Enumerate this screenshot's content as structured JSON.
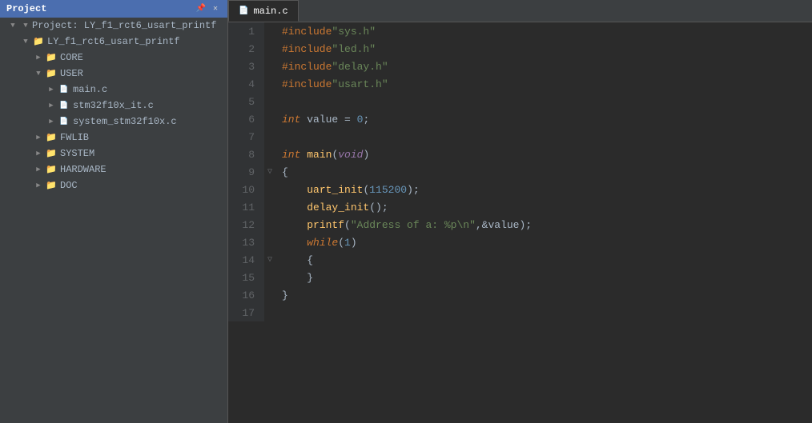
{
  "titlebar": {
    "label": "Project"
  },
  "sidebar": {
    "header": "Project",
    "pin_label": "📌",
    "close_label": "✕",
    "items": [
      {
        "id": "project-root",
        "label": "Project: LY_f1_rct6_usart_printf",
        "indent": 1,
        "type": "root",
        "expanded": true
      },
      {
        "id": "project-node",
        "label": "LY_f1_rct6_usart_printf",
        "indent": 2,
        "type": "folder",
        "expanded": true
      },
      {
        "id": "core",
        "label": "CORE",
        "indent": 3,
        "type": "folder",
        "expanded": false
      },
      {
        "id": "user",
        "label": "USER",
        "indent": 3,
        "type": "folder",
        "expanded": true
      },
      {
        "id": "main-c",
        "label": "main.c",
        "indent": 4,
        "type": "file"
      },
      {
        "id": "stm32f10x",
        "label": "stm32f10x_it.c",
        "indent": 4,
        "type": "file"
      },
      {
        "id": "system-stm",
        "label": "system_stm32f10x.c",
        "indent": 4,
        "type": "file"
      },
      {
        "id": "fwlib",
        "label": "FWLIB",
        "indent": 3,
        "type": "folder",
        "expanded": false
      },
      {
        "id": "system",
        "label": "SYSTEM",
        "indent": 3,
        "type": "folder",
        "expanded": false
      },
      {
        "id": "hardware",
        "label": "HARDWARE",
        "indent": 3,
        "type": "folder",
        "expanded": false
      },
      {
        "id": "doc",
        "label": "DOC",
        "indent": 3,
        "type": "folder",
        "expanded": false
      }
    ]
  },
  "tab": {
    "label": "main.c"
  },
  "code": {
    "lines": [
      {
        "num": 1,
        "content": "#include \"sys.h\""
      },
      {
        "num": 2,
        "content": "#include \"led.h\""
      },
      {
        "num": 3,
        "content": "#include \"delay.h\""
      },
      {
        "num": 4,
        "content": "#include \"usart.h\""
      },
      {
        "num": 5,
        "content": ""
      },
      {
        "num": 6,
        "content": "int value = 0;"
      },
      {
        "num": 7,
        "content": ""
      },
      {
        "num": 8,
        "content": "int main(void)"
      },
      {
        "num": 9,
        "content": "{",
        "gutter": "▽"
      },
      {
        "num": 10,
        "content": "    uart_init(115200);"
      },
      {
        "num": 11,
        "content": "    delay_init();"
      },
      {
        "num": 12,
        "content": "    printf(\"Address of a: %p\\n\",&value);"
      },
      {
        "num": 13,
        "content": "    while(1)"
      },
      {
        "num": 14,
        "content": "    {",
        "gutter": "▽"
      },
      {
        "num": 15,
        "content": "    }"
      },
      {
        "num": 16,
        "content": "}"
      },
      {
        "num": 17,
        "content": ""
      }
    ]
  }
}
